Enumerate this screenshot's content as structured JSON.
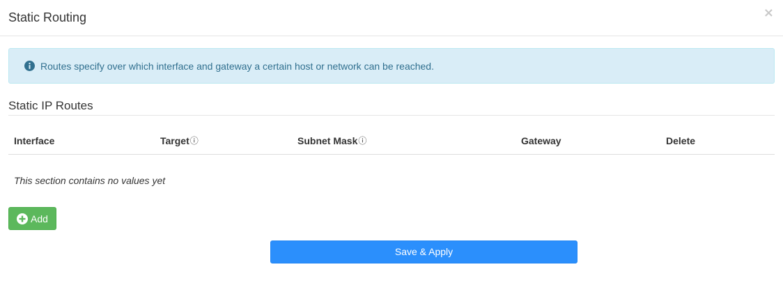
{
  "modal": {
    "title": "Static Routing",
    "close_glyph": "×"
  },
  "alert": {
    "icon": "info-circle-icon",
    "text": "Routes specify over which interface and gateway a certain host or network can be reached."
  },
  "routes_section": {
    "title": "Static IP Routes",
    "columns": [
      {
        "label": "Interface",
        "has_help": false
      },
      {
        "label": "Target",
        "has_help": true
      },
      {
        "label": "Subnet Mask",
        "has_help": true
      },
      {
        "label": "Gateway",
        "has_help": false
      },
      {
        "label": "Delete",
        "has_help": false
      }
    ],
    "help_glyph": "?",
    "empty_text": "This section contains no values yet",
    "add_label": "Add"
  },
  "footer": {
    "save_label": "Save & Apply"
  },
  "colors": {
    "alert_bg": "#d9edf7",
    "alert_text": "#31708f",
    "add_button": "#5cb85c",
    "save_button": "#2b8ffc"
  }
}
